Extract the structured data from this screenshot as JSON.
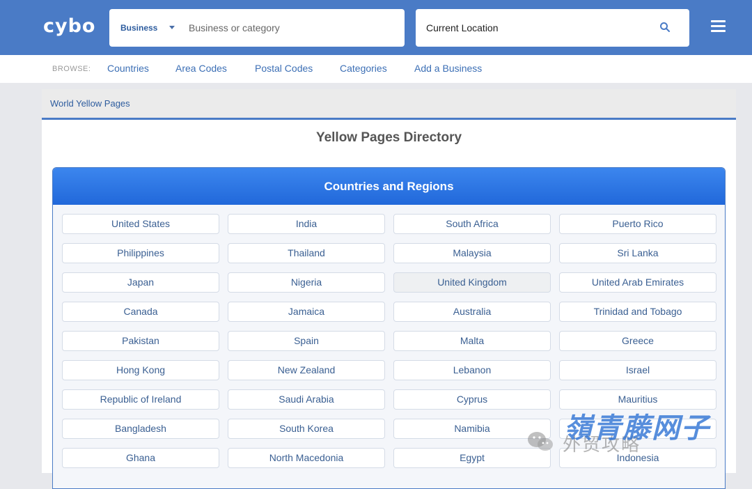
{
  "header": {
    "logo": "cybo",
    "search_type": "Business",
    "search_placeholder": "Business or category",
    "location_placeholder": "Current Location",
    "icons": [
      "search-icon",
      "menu-icon"
    ]
  },
  "browse": {
    "label": "BROWSE:",
    "links": [
      "Countries",
      "Area Codes",
      "Postal Codes",
      "Categories",
      "Add a Business"
    ]
  },
  "breadcrumb": "World Yellow Pages",
  "page_title": "Yellow Pages Directory",
  "section_title": "Countries and Regions",
  "countries": [
    "United States",
    "India",
    "South Africa",
    "Puerto Rico",
    "Philippines",
    "Thailand",
    "Malaysia",
    "Sri Lanka",
    "Japan",
    "Nigeria",
    "United Kingdom",
    "United Arab Emirates",
    "Canada",
    "Jamaica",
    "Australia",
    "Trinidad and Tobago",
    "Pakistan",
    "Spain",
    "Malta",
    "Greece",
    "Hong Kong",
    "New Zealand",
    "Lebanon",
    "Israel",
    "Republic of Ireland",
    "Saudi Arabia",
    "Cyprus",
    "Mauritius",
    "Bangladesh",
    "South Korea",
    "Namibia",
    "",
    "Ghana",
    "North Macedonia",
    "Egypt",
    "Indonesia"
  ],
  "hovered_country": "United Kingdom",
  "watermark": {
    "big": "嶺青藤网子",
    "sub": "外贸攻略"
  },
  "colors": {
    "header_blue": "#4a7bc6",
    "section_header_blue": "#2a74e2",
    "link_blue": "#3a5f92"
  }
}
